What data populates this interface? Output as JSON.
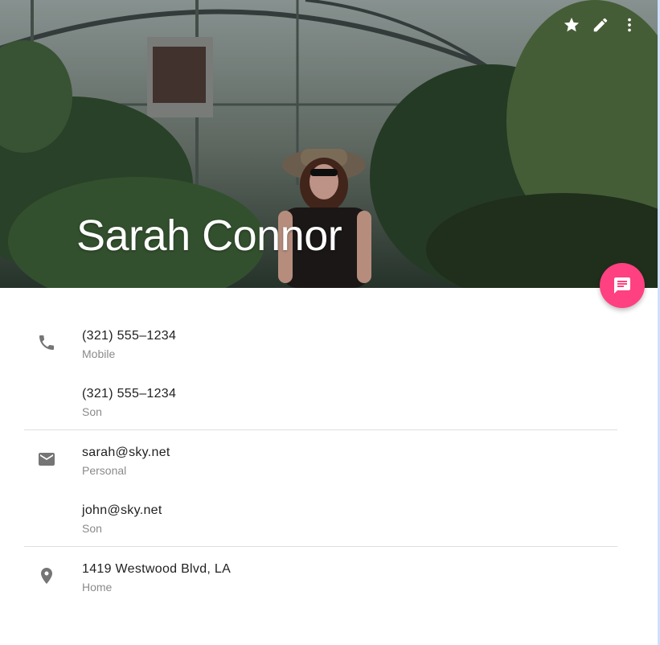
{
  "header": {
    "name": "Sarah Connor",
    "actions": [
      {
        "name": "star-icon"
      },
      {
        "name": "edit-icon"
      },
      {
        "name": "more-vert-icon"
      }
    ]
  },
  "fab": {
    "icon": "message-icon",
    "color": "#ff4081"
  },
  "sections": [
    {
      "icon": "phone-icon",
      "items": [
        {
          "value": "(321) 555–1234",
          "label": "Mobile"
        },
        {
          "value": "(321) 555–1234",
          "label": "Son"
        }
      ]
    },
    {
      "icon": "email-icon",
      "items": [
        {
          "value": "sarah@sky.net",
          "label": "Personal"
        },
        {
          "value": "john@sky.net",
          "label": "Son"
        }
      ]
    },
    {
      "icon": "location-icon",
      "items": [
        {
          "value": "1419 Westwood Blvd, LA",
          "label": "Home"
        }
      ]
    }
  ]
}
